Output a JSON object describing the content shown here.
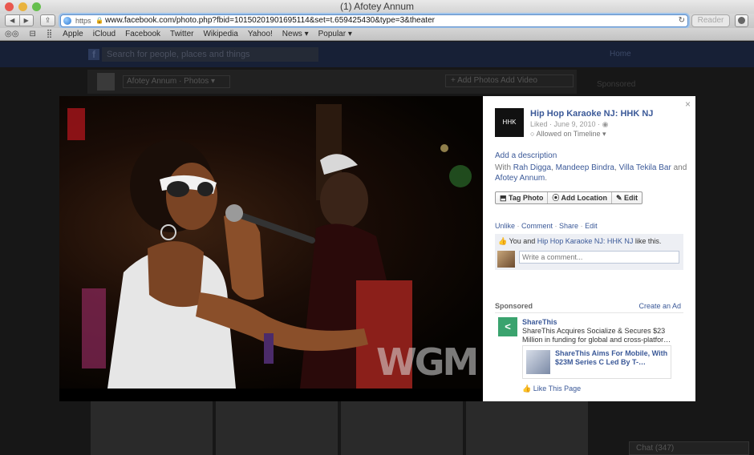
{
  "browser": {
    "window_title": "(1) Afotey Annum",
    "url_scheme": "https",
    "url": "www.facebook.com/photo.php?fbid=10150201901695114&set=t.659425430&type=3&theater",
    "reader_label": "Reader",
    "bookmarks": [
      "Apple",
      "iCloud",
      "Facebook",
      "Twitter",
      "Wikipedia",
      "Yahoo!",
      "News ▾",
      "Popular ▾"
    ]
  },
  "facebook": {
    "search_placeholder": "Search for people, places and things",
    "home_label": "Home",
    "profile_name": "Afotey Annum · Photos ▾",
    "header_buttons": "+ Add Photos   Add Video",
    "sponsored_bg": "Sponsored",
    "chat_label": "Chat (347)"
  },
  "photo": {
    "watermark": "WGM",
    "close_glyph": "×"
  },
  "panel": {
    "page_name": "Hip Hop Karaoke NJ: HHK NJ",
    "page_pic_text": "HHK",
    "liked_date": "Liked · June 9, 2010 · ",
    "timeline": "○ Allowed on Timeline ▾",
    "add_description": "Add a description",
    "with_prefix": "With ",
    "tagged": [
      "Rah Digga",
      "Mandeep Bindra",
      "Villa Tekila Bar"
    ],
    "and_word": " and ",
    "last_tagged": "Afotey Annum",
    "actions": [
      "⬒ Tag Photo",
      "⦿ Add Location",
      "✎ Edit"
    ],
    "ufi": [
      "Unlike",
      "Comment",
      "Share",
      "Edit"
    ],
    "like_line_prefix": "You and ",
    "like_line_page": "Hip Hop Karaoke NJ: HHK NJ",
    "like_line_suffix": " like this.",
    "comment_placeholder": "Write a comment...",
    "sponsored_label": "Sponsored",
    "create_ad": "Create an Ad",
    "ad": {
      "title": "ShareThis",
      "text": "ShareThis Acquires Socialize & Secures $23 Million in funding for global and cross-platfor…",
      "card_title": "ShareThis Aims For Mobile, With $23M Series C Led By T-…",
      "like_page": "Like This Page"
    }
  }
}
